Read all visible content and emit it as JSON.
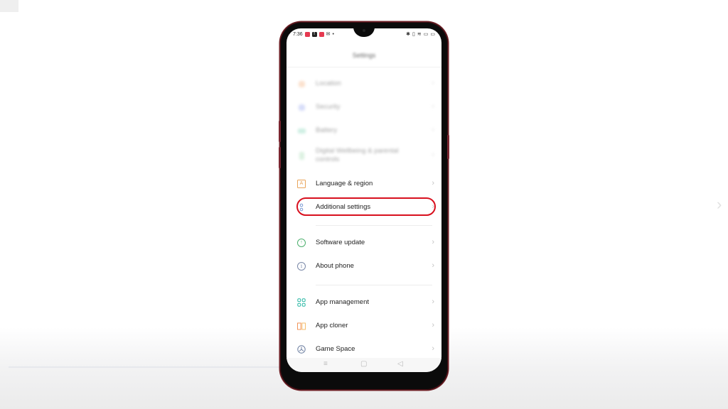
{
  "status_bar": {
    "time": "7:36",
    "left_icons": [
      "app-notification-icon",
      "facebook-icon",
      "app-notification-icon",
      "gmail-icon",
      "dot-icon"
    ],
    "right_icons": [
      "bluetooth-icon",
      "vibrate-icon",
      "wifi-icon",
      "sim-icon",
      "battery-icon"
    ]
  },
  "header": {
    "title": "Settings"
  },
  "settings_items": [
    {
      "id": "location",
      "label": "Location",
      "icon": "location-icon",
      "icon_color": "#f4a36a",
      "blurred": true
    },
    {
      "id": "security",
      "label": "Security",
      "icon": "security-icon",
      "icon_color": "#7d8ff0",
      "blurred": true
    },
    {
      "id": "battery",
      "label": "Battery",
      "icon": "battery-icon",
      "icon_color": "#4fc8a0",
      "blurred": true
    },
    {
      "id": "digital-wellbeing",
      "label": "Digital Wellbeing & parental controls",
      "icon": "wellbeing-icon",
      "icon_color": "#6cc58a",
      "blurred": true
    },
    {
      "id": "language-region",
      "label": "Language & region",
      "icon": "language-icon",
      "icon_glyph": "A",
      "icon_color": "#e9a45a",
      "blurred": false
    },
    {
      "id": "additional-settings",
      "label": "Additional settings",
      "icon": "additional-settings-icon",
      "icon_color": "#6b8fd0",
      "blurred": false,
      "highlighted": true
    },
    {
      "id": "software-update",
      "label": "Software update",
      "icon": "update-icon",
      "icon_glyph": "↑",
      "icon_color": "#4db06e",
      "blurred": false
    },
    {
      "id": "about-phone",
      "label": "About phone",
      "icon": "info-icon",
      "icon_glyph": "i",
      "icon_color": "#7a88a8",
      "blurred": false
    },
    {
      "id": "app-management",
      "label": "App management",
      "icon": "app-management-icon",
      "icon_color": "#2fb9a6",
      "blurred": false
    },
    {
      "id": "app-cloner",
      "label": "App cloner",
      "icon": "app-cloner-icon",
      "icon_color": "#f08a4b",
      "blurred": false
    },
    {
      "id": "game-space",
      "label": "Game Space",
      "icon": "game-space-icon",
      "icon_color": "#6c7ea0",
      "blurred": false
    }
  ],
  "chevron": "›",
  "nav_bar": {
    "menu": "≡",
    "home": "▢",
    "back": "◁"
  },
  "highlight_color": "#d8101e",
  "next_slide_arrow": "›"
}
